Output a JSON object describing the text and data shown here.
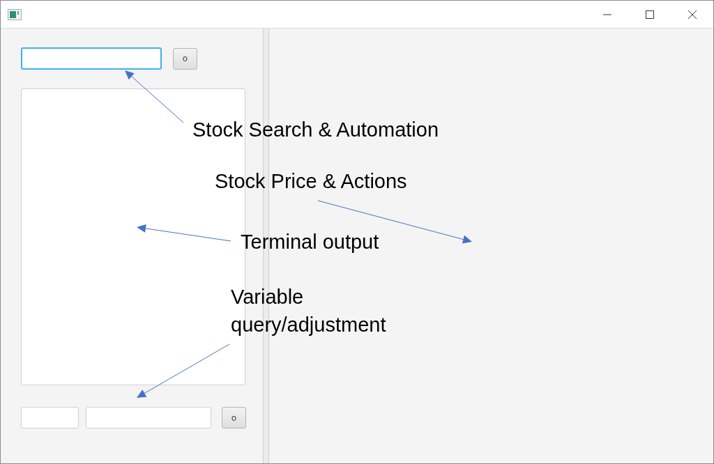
{
  "search": {
    "focused": true,
    "button": "o"
  },
  "terminal": {
    "focused": false
  },
  "variable_row": {
    "fields": [
      {
        "focused": false
      },
      {
        "focused": false
      }
    ],
    "button": "o"
  },
  "annotations": [
    {
      "kind": "label",
      "text": "Stock Search & Automation"
    },
    {
      "kind": "label",
      "text": "Stock Price & Actions"
    },
    {
      "kind": "label",
      "text": "Terminal output"
    },
    {
      "kind": "label",
      "text": "Variable query/adjustment"
    }
  ]
}
